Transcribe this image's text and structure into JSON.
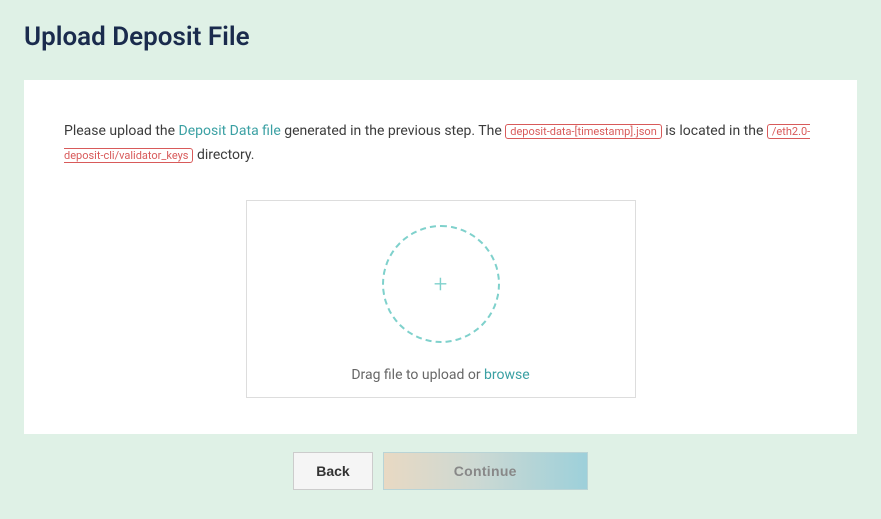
{
  "page": {
    "title": "Upload Deposit File"
  },
  "instruction": {
    "prefix": "Please upload the ",
    "link_text": "Deposit Data file",
    "mid1": " generated in the previous step. The ",
    "code1": "deposit-data-[timestamp].json",
    "mid2": " is located in the ",
    "code2": "/eth2.0-deposit-cli/validator_keys",
    "suffix": " directory."
  },
  "dropzone": {
    "plus": "+",
    "text_prefix": "Drag file to upload or ",
    "browse": "browse"
  },
  "buttons": {
    "back": "Back",
    "continue": "Continue"
  }
}
